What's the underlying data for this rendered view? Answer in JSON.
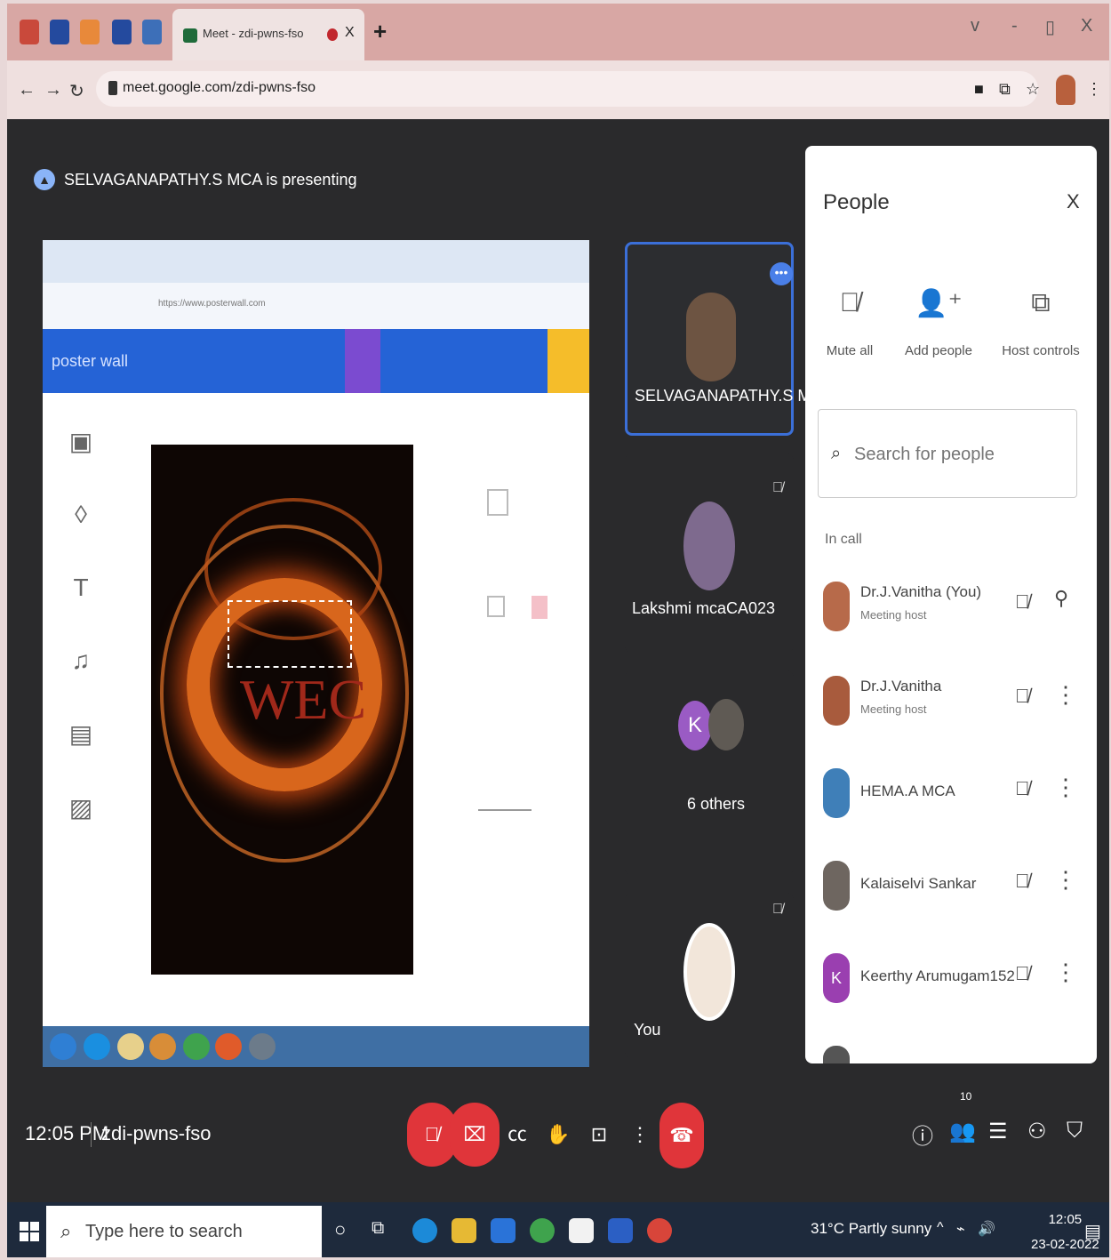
{
  "browser": {
    "tab_title": "Meet - zdi-pwns-fso",
    "tab_close": "X",
    "new_tab": "+",
    "window_controls": [
      "v",
      "-",
      "▯",
      "X"
    ],
    "url": "meet.google.com/zdi-pwns-fso"
  },
  "meet": {
    "presenting_text": "SELVAGANAPATHY.S MCA is presenting",
    "shared_screen": {
      "brand": "poster wall",
      "canvas_text": "WEC",
      "url": "https://www.posterwall.com"
    },
    "tiles": [
      {
        "name": "SELVAGANAPATHY.S MCA"
      },
      {
        "name": "Lakshmi mcaCA023"
      },
      {
        "name": "6 others",
        "initial": "K"
      },
      {
        "name": "You"
      }
    ],
    "time": "12:05 PM",
    "meeting_code": "zdi-pwns-fso",
    "participant_count": "10"
  },
  "people": {
    "title": "People",
    "close": "X",
    "actions": [
      {
        "label": "Mute all",
        "icon": "mic-off-icon"
      },
      {
        "label": "Add people",
        "icon": "add-person-icon"
      },
      {
        "label": "Host controls",
        "icon": "host-controls-icon"
      }
    ],
    "search_placeholder": "Search for people",
    "section": "In call",
    "participants": [
      {
        "name": "Dr.J.Vanitha (You)",
        "role": "Meeting host"
      },
      {
        "name": "Dr.J.Vanitha",
        "role": "Meeting host"
      },
      {
        "name": "HEMA.A MCA",
        "role": ""
      },
      {
        "name": "Kalaiselvi Sankar",
        "role": ""
      },
      {
        "name": "Keerthy Arumugam152",
        "role": ""
      }
    ]
  },
  "taskbar": {
    "search_placeholder": "Type here to search",
    "weather": "31°C  Partly sunny",
    "time": "12:05",
    "date": "23-02-2022"
  },
  "colors": {
    "tab_bar": "#d8a7a4",
    "meet_bg": "#2a2a2c",
    "danger": "#e0353a",
    "accent": "#3b6fd8"
  }
}
